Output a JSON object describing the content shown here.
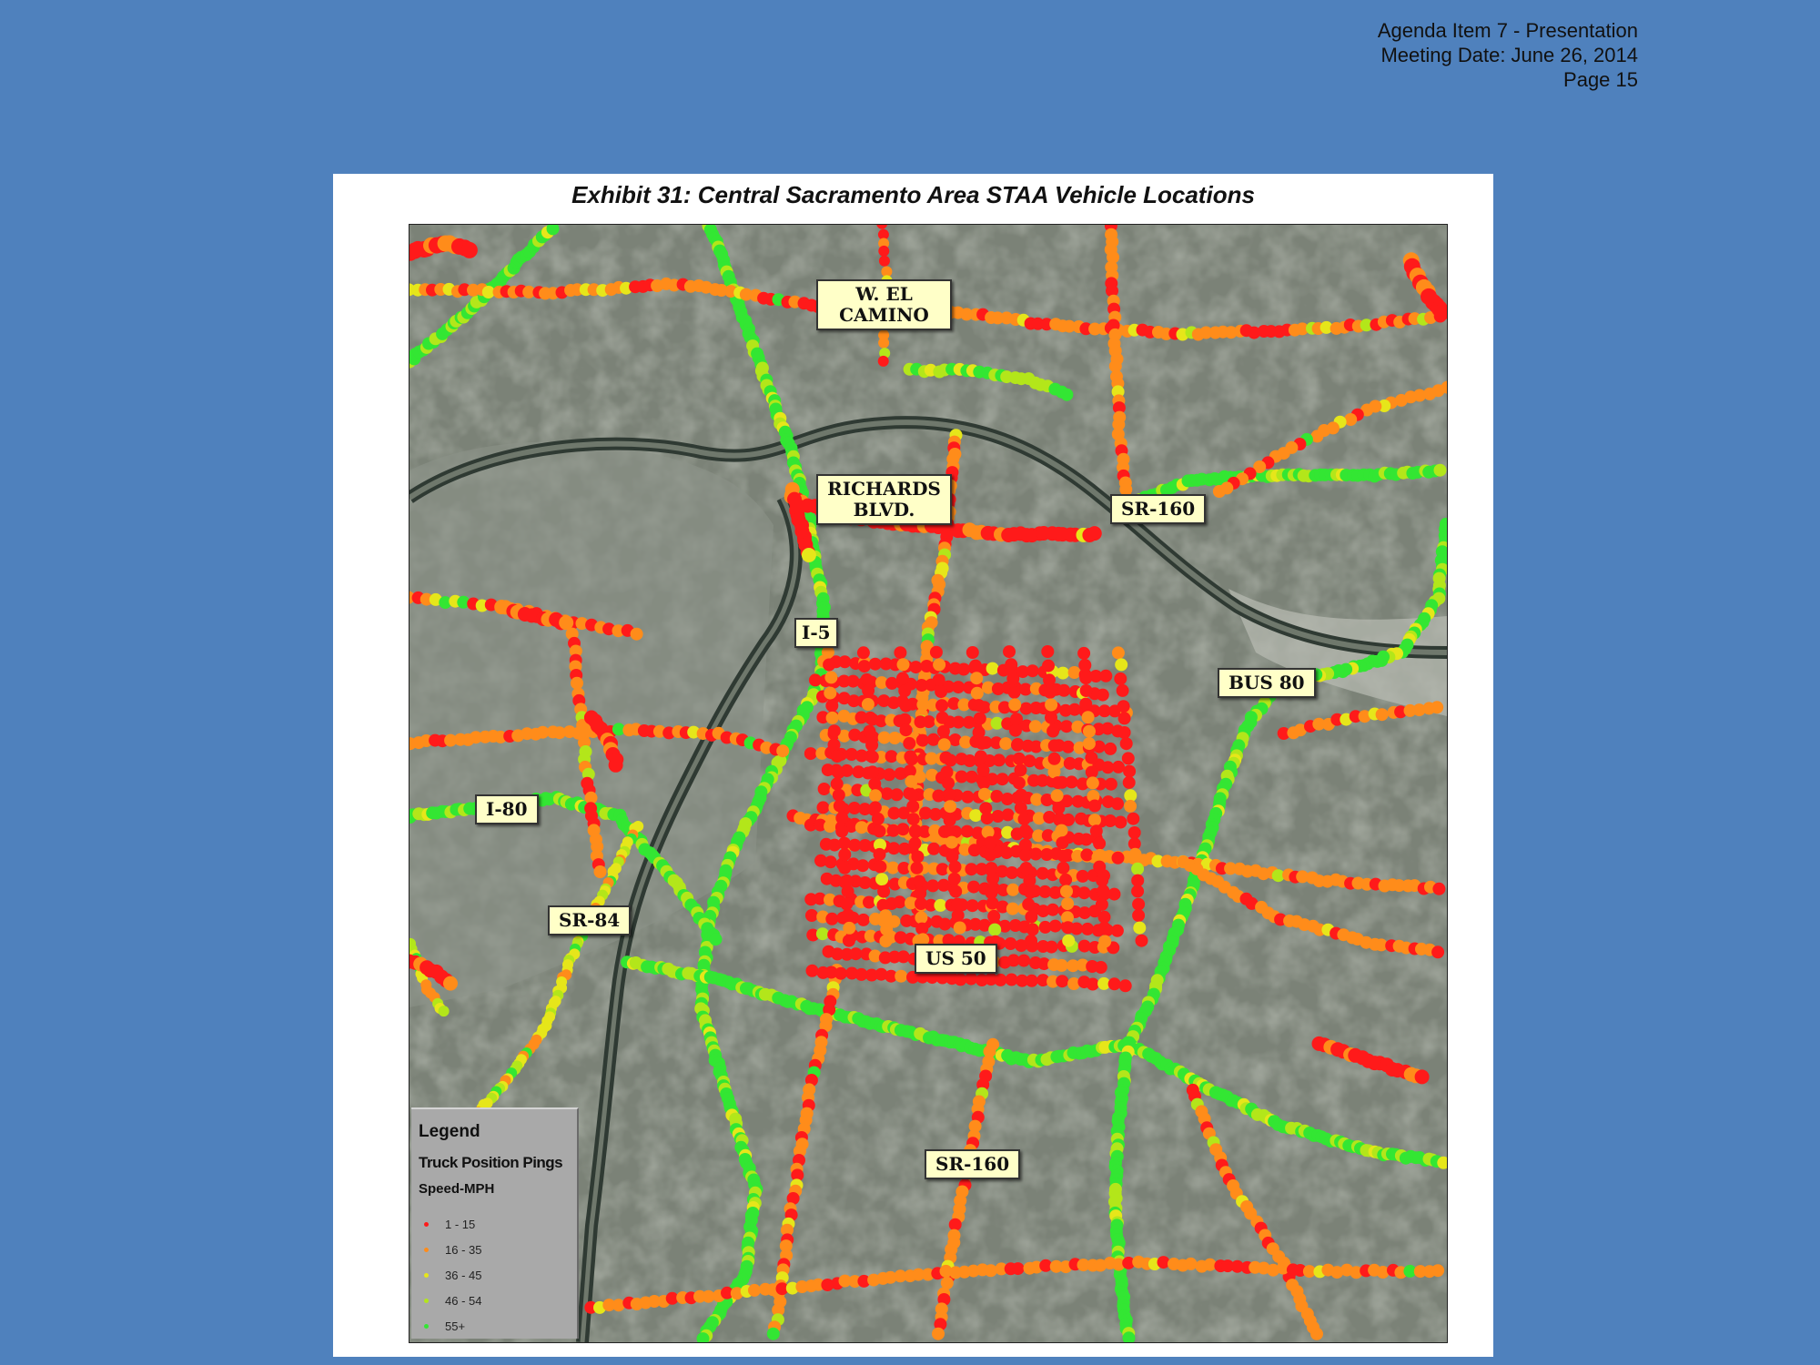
{
  "header": {
    "line1": "Agenda Item 7 - Presentation",
    "line2": "Meeting Date:  June 26, 2014",
    "line3": "Page 15"
  },
  "exhibit": {
    "title": "Exhibit 31: Central Sacramento Area STAA Vehicle Locations"
  },
  "map": {
    "labels": {
      "w_el_camino": [
        "W. EL",
        "CAMINO"
      ],
      "richards_blvd": [
        "RICHARDS",
        "BLVD."
      ],
      "sr160_north": "SR-160",
      "i5": "I-5",
      "bus80": "BUS 80",
      "i80": "I-80",
      "sr84": "SR-84",
      "us50": "US 50",
      "sr160_south": "SR-160"
    },
    "legend": {
      "title": "Legend",
      "subtitle": "Truck Position Pings",
      "speed_label": "Speed-MPH",
      "items": [
        {
          "label": "1 - 15",
          "color": "#ff1a1a"
        },
        {
          "label": "16 - 35",
          "color": "#ff8c1a"
        },
        {
          "label": "36 - 45",
          "color": "#e6e61a"
        },
        {
          "label": "46 - 54",
          "color": "#b3e61a"
        },
        {
          "label": "55+",
          "color": "#33e633"
        }
      ]
    }
  }
}
